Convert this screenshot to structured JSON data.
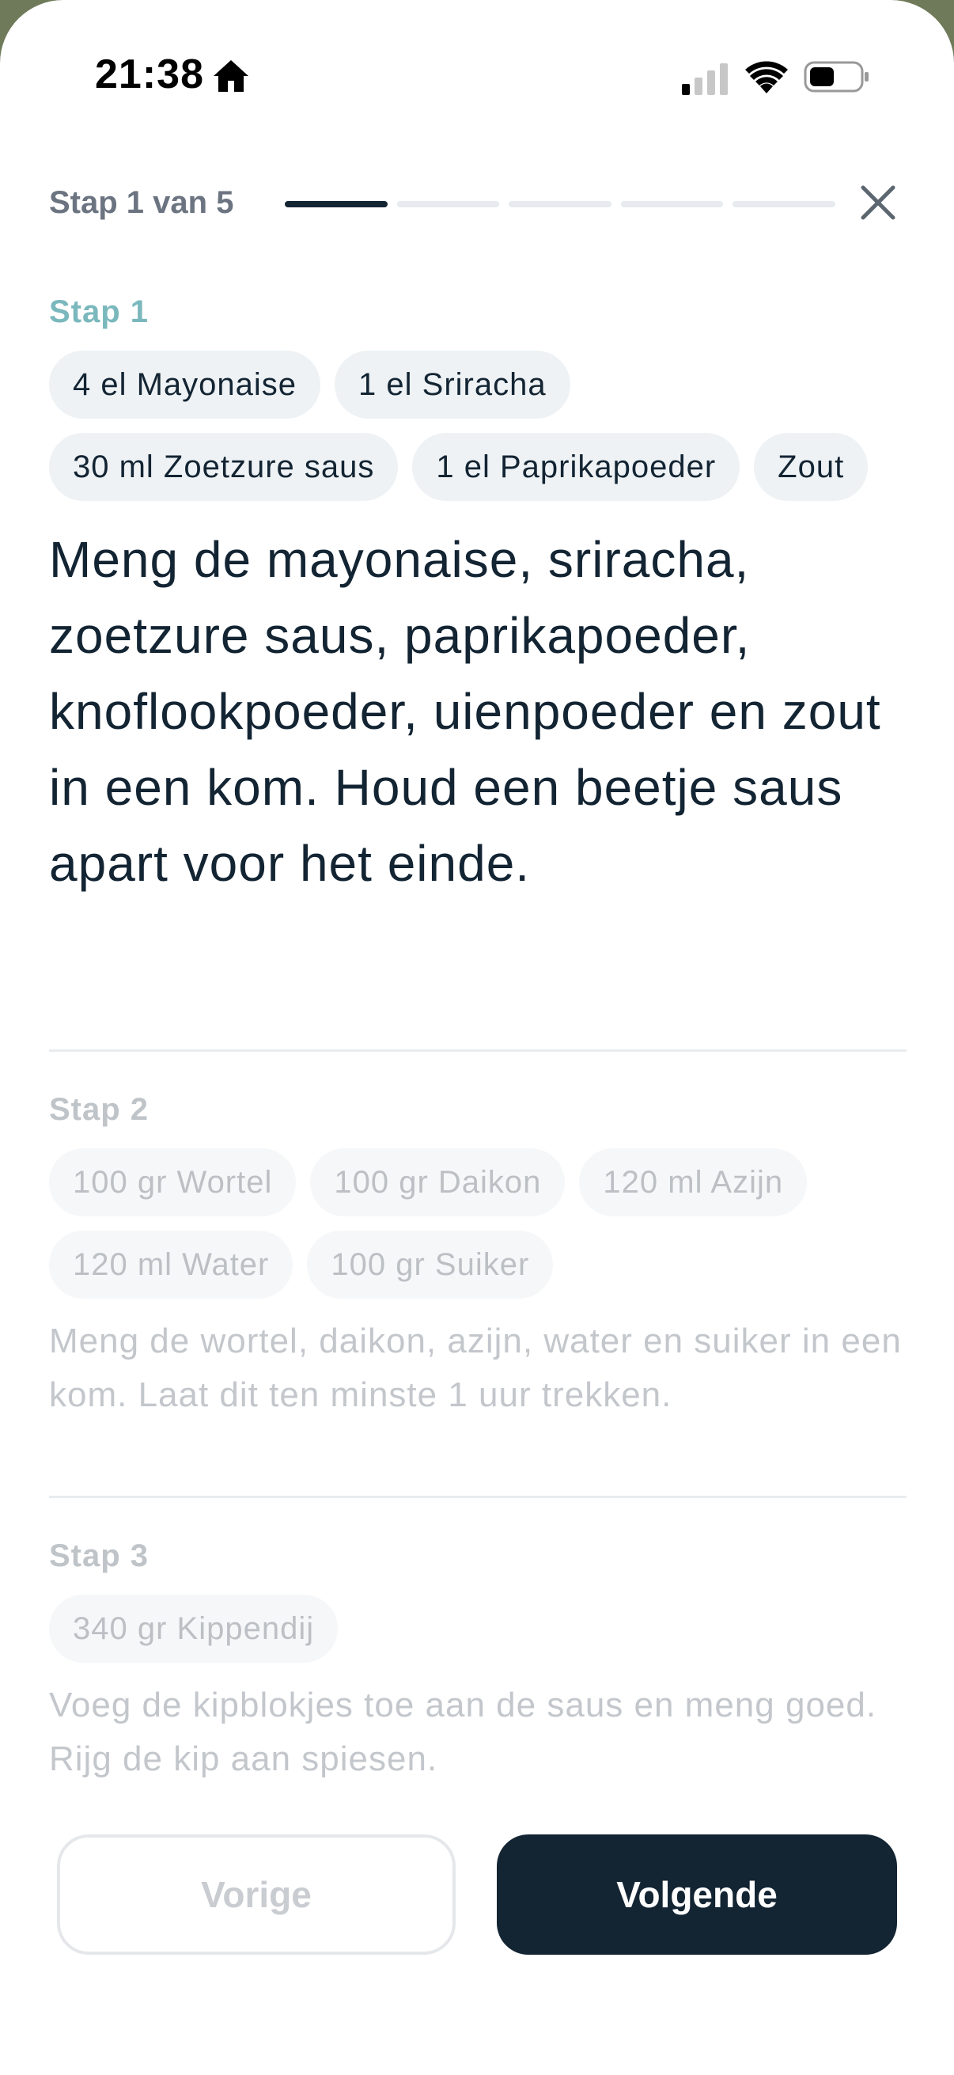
{
  "status_bar": {
    "time": "21:38"
  },
  "header": {
    "step_counter": "Stap 1 van 5",
    "progress": {
      "current": 1,
      "total": 5
    }
  },
  "steps": [
    {
      "label": "Stap 1",
      "chips": [
        "4 el Mayonaise",
        "1 el Sriracha",
        "30 ml Zoetzure saus",
        "1 el Paprikapoeder",
        "Zout"
      ],
      "description": "Meng de mayonaise, sriracha, zoetzure saus, paprikapoeder, knoflookpoeder, uienpoeder en zout in een kom. Houd een beetje saus apart voor het einde."
    },
    {
      "label": "Stap 2",
      "chips": [
        "100 gr Wortel",
        "100 gr Daikon",
        "120 ml Azijn",
        "120 ml Water",
        "100 gr Suiker"
      ],
      "description": "Meng de wortel, daikon, azijn, water en suiker in een kom. Laat dit ten minste 1 uur trekken."
    },
    {
      "label": "Stap 3",
      "chips": [
        "340 gr Kippendij"
      ],
      "description": "Voeg de kipblokjes toe aan de saus en meng goed. Rijg de kip aan spiesen."
    }
  ],
  "buttons": {
    "previous": "Vorige",
    "next": "Volgende"
  },
  "colors": {
    "accent": "#7ab8bd",
    "primary": "#132433"
  }
}
